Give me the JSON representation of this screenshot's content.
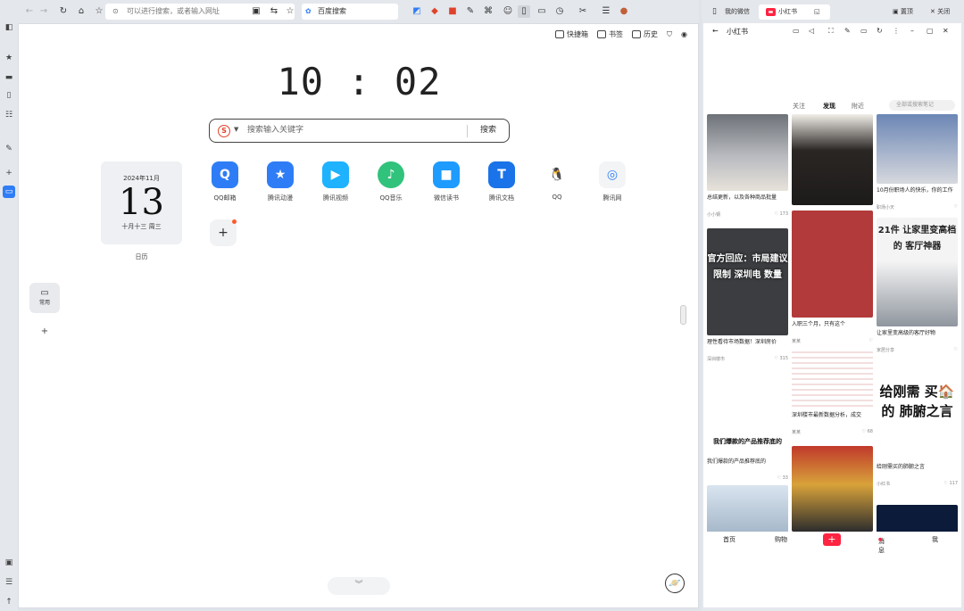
{
  "rail": [
    "sidebar-toggle-icon",
    "star-icon",
    "folder-icon",
    "phone-icon",
    "grid-icon",
    "puzzle-icon",
    "add-icon",
    "browser-icon",
    "download-icon",
    "trash-icon",
    "upload-icon"
  ],
  "toolbar": {
    "address_placeholder": "可以进行搜索，或者输入网址",
    "search_engine_label": "百度搜索"
  },
  "newtab": {
    "top_links": [
      "快捷箱",
      "书签",
      "历史"
    ],
    "clock": "10 : 02",
    "search": {
      "placeholder": "搜索输入关键字",
      "button": "搜索"
    },
    "calendar": {
      "year_month": "2024年11月",
      "day": "13",
      "lunar": "十月十三 周三",
      "label": "日历"
    },
    "apps": [
      {
        "label": "QQ邮箱",
        "color": "#2f7df6",
        "glyph": "Q"
      },
      {
        "label": "腾讯动漫",
        "color": "#2f7df6",
        "glyph": "★"
      },
      {
        "label": "腾讯视频",
        "color": "#1eb2ff",
        "glyph": "▶"
      },
      {
        "label": "QQ音乐",
        "color": "#31c27c",
        "glyph": "♪"
      },
      {
        "label": "微信读书",
        "color": "#1e9bff",
        "glyph": "■"
      },
      {
        "label": "腾讯文档",
        "color": "#1a73e8",
        "glyph": "T"
      },
      {
        "label": "QQ",
        "color": "#ffffff",
        "glyph": "🐧"
      },
      {
        "label": "腾讯网",
        "color": "#f3f4f6",
        "glyph": "◎"
      }
    ],
    "side_category": "常用"
  },
  "right_panel": {
    "tabs": [
      "我的微信",
      "小红书"
    ],
    "window_actions": [
      "置顶",
      "关闭"
    ],
    "page_title": "小红书",
    "feed_tabs": [
      "关注",
      "发现",
      "附近"
    ],
    "feed_search": "全部或搜索笔记",
    "cards": [
      {
        "title": "总结更新，以及各种商品批量",
        "user": "小小钢",
        "likes": "173",
        "image_text": ""
      },
      {
        "title": "",
        "user": "",
        "likes": "",
        "image_text": ""
      },
      {
        "title": "10月份职场人的快乐，你的工作",
        "user": "职场小天",
        "likes": "",
        "image_text": ""
      },
      {
        "title": "",
        "user": "",
        "likes": "",
        "image_text": "21件 让家里变高档的 客厅神器"
      },
      {
        "title": "理性看待市场数据！深圳房价",
        "user": "深圳楼市",
        "likes": "315",
        "image_text": "官方回应：市局建议 限制 深圳电 数量"
      },
      {
        "title": "入职三个月，只有这个",
        "user": "某某",
        "likes": "",
        "image_text": ""
      },
      {
        "title": "让家里变高级的客厅好物",
        "user": "家居分享",
        "likes": "",
        "image_text": ""
      },
      {
        "title": "我们爆款的产品推荐底的",
        "user": "",
        "likes": "33",
        "image_text": "我们爆款的产品推荐底的"
      },
      {
        "title": "深圳楼市最新数据分析，成交",
        "user": "某某",
        "likes": "68",
        "image_text": ""
      },
      {
        "title": "给刚需买的肺腑之言",
        "user": "小红书",
        "likes": "117",
        "image_text": "给刚需 买🏠的 肺腑之言"
      },
      {
        "title": "",
        "user": "",
        "likes": "",
        "image_text": ""
      },
      {
        "title": "",
        "user": "",
        "likes": "",
        "image_text": ""
      },
      {
        "title": "",
        "user": "",
        "likes": "",
        "image_text": ""
      }
    ],
    "nav": [
      "首页",
      "购物",
      "+",
      "消息",
      "我"
    ]
  }
}
